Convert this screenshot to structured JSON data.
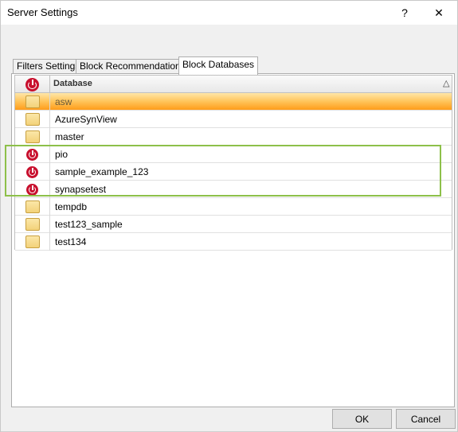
{
  "window": {
    "title": "Server Settings",
    "help_label": "?",
    "close_label": "✕"
  },
  "tabs": [
    {
      "label": "Filters Settings",
      "active": false
    },
    {
      "label": "Block Recommendations",
      "active": false
    },
    {
      "label": "Block Databases",
      "active": true
    }
  ],
  "grid": {
    "header_label": "Database",
    "sort_indicator": "△",
    "header_icon": "power-icon",
    "rows": [
      {
        "name": "asw",
        "icon": "folder-icon",
        "blocked": false,
        "selected": true
      },
      {
        "name": "AzureSynView",
        "icon": "folder-icon",
        "blocked": false,
        "selected": false
      },
      {
        "name": "master",
        "icon": "folder-icon",
        "blocked": false,
        "selected": false
      },
      {
        "name": "pio",
        "icon": "power-icon",
        "blocked": true,
        "selected": false
      },
      {
        "name": "sample_example_123",
        "icon": "power-icon",
        "blocked": true,
        "selected": false
      },
      {
        "name": "synapsetest",
        "icon": "power-icon",
        "blocked": true,
        "selected": false
      },
      {
        "name": "tempdb",
        "icon": "folder-icon",
        "blocked": false,
        "selected": false
      },
      {
        "name": "test123_sample",
        "icon": "folder-icon",
        "blocked": false,
        "selected": false
      },
      {
        "name": "test134",
        "icon": "folder-icon",
        "blocked": false,
        "selected": false
      }
    ]
  },
  "buttons": {
    "ok_label": "OK",
    "cancel_label": "Cancel"
  },
  "colors": {
    "blocked_icon": "#c8102e",
    "highlight_border": "#8dc04a",
    "selected_row": "#ffc45a"
  }
}
